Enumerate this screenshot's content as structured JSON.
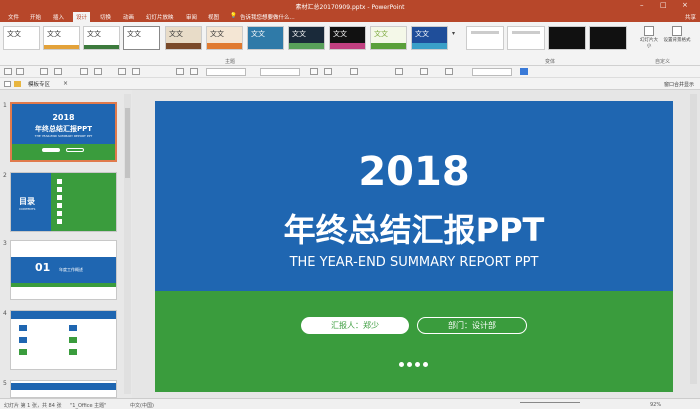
{
  "window": {
    "title": "素材汇总20170909.pptx - PowerPoint"
  },
  "menu": {
    "file": "文件",
    "home": "开始",
    "insert": "插入",
    "design": "设计",
    "transitions": "切换",
    "animations": "动画",
    "slideshow": "幻灯片放映",
    "review": "审阅",
    "view": "视图",
    "tellme": "告诉我您想要做什么...",
    "share": "共享"
  },
  "ribbon": {
    "themes_label": "主题",
    "variants_label": "变体",
    "customize_label": "自定义",
    "theme_sample": "文文",
    "slide_size": "幻灯片大小",
    "format_bg": "设置背景格式"
  },
  "toolbar2": {
    "tab": "模板专区",
    "thumbs": "窗口合并显示"
  },
  "slides": {
    "s1": {
      "num": "1",
      "year": "2018",
      "title": "年终总结汇报PPT",
      "sub": "THE YEAR-END SUMMARY REPORT PPT"
    },
    "s2": {
      "num": "2",
      "title": "目录",
      "sub": "CONTENTS"
    },
    "s3": {
      "num": "3",
      "big": "01",
      "text": "年度工作概述"
    },
    "s4": {
      "num": "4",
      "text": "..."
    },
    "s5": {
      "num": "5",
      "text": "..."
    }
  },
  "main_slide": {
    "year": "2018",
    "title": "年终总结汇报PPT",
    "subtitle": "THE YEAR-END SUMMARY REPORT PPT",
    "reporter": "汇报人：郑少",
    "dept": "部门：设计部"
  },
  "status": {
    "slide": "幻灯片 第 1 张，共 84 张",
    "theme": "\"1_Office 主题\"",
    "lang": "中文(中国)",
    "zoom": "92%"
  },
  "colors": {
    "accent": "#b7472a",
    "slide_blue": "#1f66b1",
    "slide_green": "#3a9c3d"
  }
}
